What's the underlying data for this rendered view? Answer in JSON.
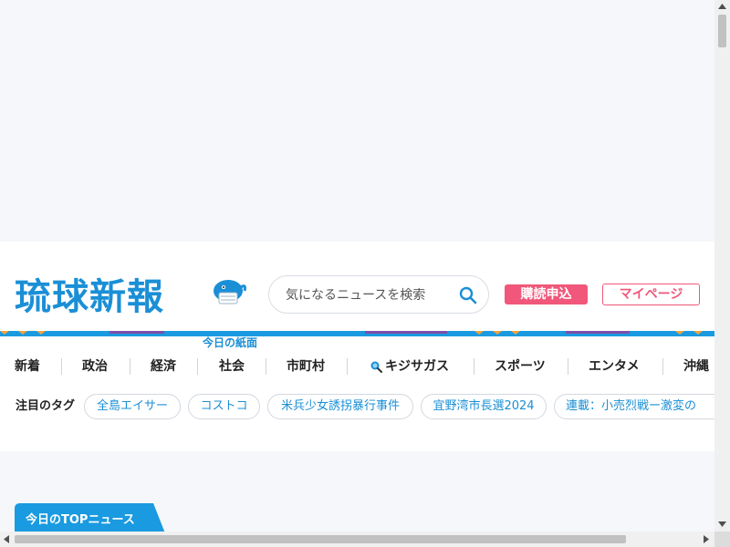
{
  "header": {
    "logo_text": "琉球新報",
    "paper_link": "今日の紙面",
    "search": {
      "placeholder": "気になるニュースを検索",
      "value": ""
    },
    "subscribe_label": "購読申込",
    "mypage_label": "マイページ"
  },
  "nav": {
    "items": [
      {
        "label": "新着"
      },
      {
        "label": "政治"
      },
      {
        "label": "経済"
      },
      {
        "label": "社会"
      },
      {
        "label": "市町村"
      },
      {
        "label": "キジサガス",
        "icon": "search-icon"
      },
      {
        "label": "スポーツ"
      },
      {
        "label": "エンタメ"
      },
      {
        "label": "沖縄"
      }
    ]
  },
  "tags": {
    "label": "注目のタグ",
    "items": [
      {
        "label": "全島エイサー"
      },
      {
        "label": "コストコ"
      },
      {
        "label": "米兵少女誘拐暴行事件"
      },
      {
        "label": "宜野湾市長選2024"
      },
      {
        "label": "連載：小売烈戦ー激変の"
      }
    ]
  },
  "section": {
    "title": "今日のTOPニュース"
  },
  "colors": {
    "brand_blue": "#1a8fd6",
    "accent_pink": "#f0577a",
    "section_blue": "#1a9ae0"
  }
}
